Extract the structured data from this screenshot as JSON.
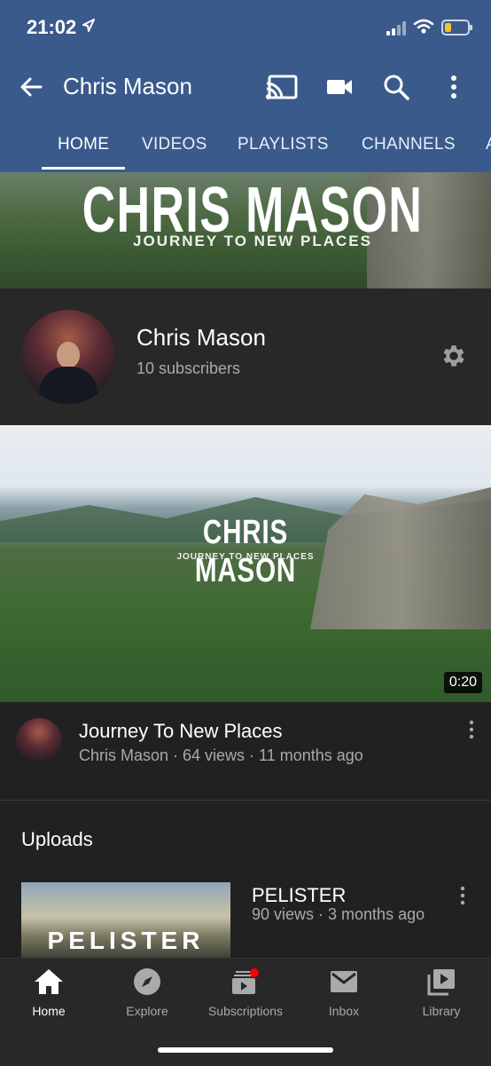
{
  "status": {
    "time": "21:02"
  },
  "appbar": {
    "title": "Chris Mason"
  },
  "tabs": [
    {
      "label": "HOME"
    },
    {
      "label": "VIDEOS"
    },
    {
      "label": "PLAYLISTS"
    },
    {
      "label": "CHANNELS"
    },
    {
      "label": "A"
    }
  ],
  "banner": {
    "title": "CHRIS MASON",
    "subtitle": "JOURNEY TO NEW PLACES"
  },
  "channel": {
    "name": "Chris Mason",
    "subscribers": "10 subscribers"
  },
  "featured": {
    "thumb_title": "CHRIS MASON",
    "thumb_subtitle": "JOURNEY TO NEW PLACES",
    "duration": "0:20",
    "title": "Journey To New Places",
    "meta": "Chris Mason · 64 views · 11 months ago"
  },
  "uploads": {
    "heading": "Uploads",
    "items": [
      {
        "thumb_text": "PELISTER",
        "title": "PELISTER",
        "meta": "90 views · 3 months ago"
      }
    ]
  },
  "bottom_nav": [
    {
      "label": "Home",
      "icon": "home-icon"
    },
    {
      "label": "Explore",
      "icon": "explore-icon"
    },
    {
      "label": "Subscriptions",
      "icon": "subscriptions-icon"
    },
    {
      "label": "Inbox",
      "icon": "inbox-icon"
    },
    {
      "label": "Library",
      "icon": "library-icon"
    }
  ],
  "colors": {
    "header": "#3a5a8c",
    "background": "#212121",
    "notification": "#ff0000"
  }
}
